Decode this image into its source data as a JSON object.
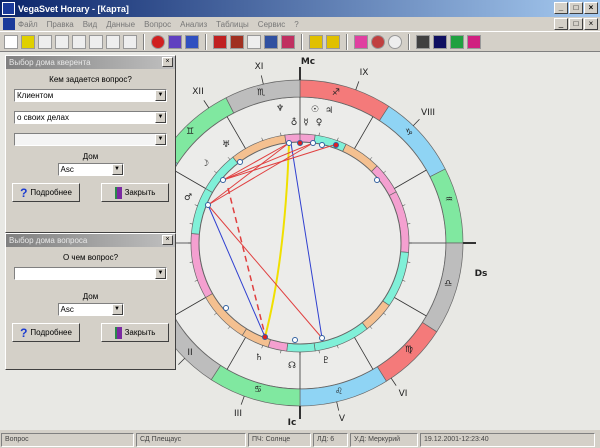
{
  "window": {
    "title": "VegaSvet Horary - [Карта]",
    "min": "_",
    "max": "□",
    "close": "×"
  },
  "menu": [
    "Файл",
    "Правка",
    "Вид",
    "Данные",
    "Вопрос",
    "Анализ",
    "Таблицы",
    "Сервис",
    "?"
  ],
  "panel1": {
    "title": "Выбор дома кверента",
    "question": "Кем задается вопрос?",
    "combo1": "Клиентом",
    "combo2": "о своих делах",
    "combo3": "",
    "house_label": "Дом",
    "house_value": "Asc",
    "details": "Подробнее",
    "close": "Закрыть"
  },
  "panel2": {
    "title": "Выбор дома вопроса",
    "question": "О чем вопрос?",
    "combo1": "",
    "house_label": "Дом",
    "house_value": "Asc",
    "details": "Подробнее",
    "close": "Закрыть"
  },
  "chart": {
    "axes": {
      "mc": "Mc",
      "ds": "Ds",
      "ic": "Ic"
    },
    "houses": {
      "xi": "XI",
      "xii": "XII",
      "ix": "IX",
      "viii": "VIII",
      "vi": "VI",
      "v": "V",
      "iii": "III",
      "ii": "II"
    },
    "signs": [
      "♐",
      "♏",
      "♎",
      "♍",
      "♌",
      "♋",
      "♊",
      "♉",
      "♒",
      "♑"
    ],
    "planets": [
      "♆",
      "☉",
      "♃",
      "♁",
      "☿",
      "♀",
      "♅",
      "☽",
      "♂",
      "♄",
      "☊",
      "♇"
    ]
  },
  "status": {
    "mode": "Вопрос",
    "sd": "СД Плещаус",
    "pch": "ПЧ: Солнце",
    "ld": "ЛД: 6",
    "ud": "У.Д: Меркурий",
    "datetime": "19.12.2001-12:23:40"
  }
}
